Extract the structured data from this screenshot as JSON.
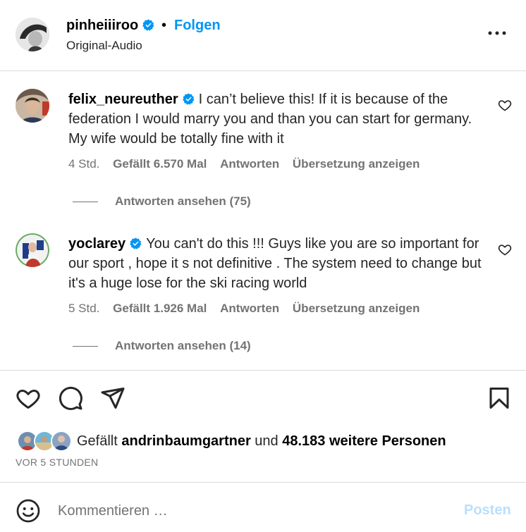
{
  "post": {
    "username": "pinheiiiroo",
    "separator": "•",
    "follow_label": "Folgen",
    "audio_label": "Original-Audio",
    "more_icon": "more-horizontal-icon"
  },
  "comments": [
    {
      "username": "felix_neureuther",
      "verified": true,
      "text": "I can’t believe this! If it is because of the federation I would marry you and than you can start for germany. My wife would be totally fine with it",
      "time": "4 Std.",
      "likes": "Gefällt 6.570 Mal",
      "reply_label": "Antworten",
      "translate_label": "Übersetzung anzeigen",
      "view_replies": "Antworten ansehen (75)"
    },
    {
      "username": "yoclarey",
      "verified": true,
      "text": "You can't do this !!! Guys like you are so important for our sport , hope it s not definitive . The system need to change but it's a huge lose for the ski racing world",
      "time": "5 Std.",
      "likes": "Gefällt 1.926 Mal",
      "reply_label": "Antworten",
      "translate_label": "Übersetzung anzeigen",
      "view_replies": "Antworten ansehen (14)"
    }
  ],
  "likes_summary": {
    "prefix": "Gefällt",
    "user": "andrinbaumgartner",
    "connector": "und",
    "count_text": "48.183 weitere Personen"
  },
  "timestamp": "VOR 5 STUNDEN",
  "comment_box": {
    "placeholder": "Kommentieren …",
    "post_label": "Posten"
  },
  "colors": {
    "accent": "#0095f6",
    "post_disabled": "#b9dffc",
    "verified": "#0095f6",
    "secondary_text": "#737373"
  }
}
